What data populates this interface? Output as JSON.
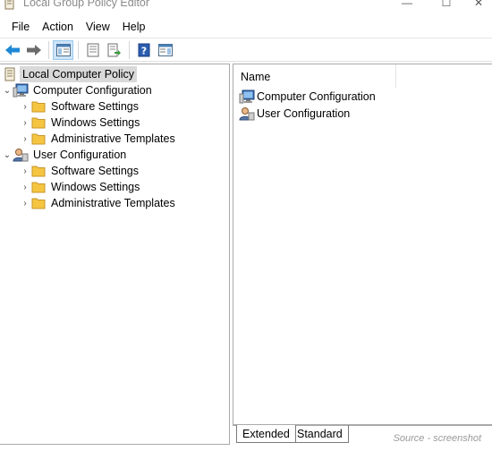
{
  "window": {
    "title": "Local Group Policy Editor",
    "minimize_glyph": "—",
    "maximize_glyph": "☐",
    "close_glyph": "✕"
  },
  "menu": [
    "File",
    "Action",
    "View",
    "Help"
  ],
  "toolbar": {
    "buttons": [
      "back-icon",
      "forward-icon",
      "show-hide-console-tree-icon",
      "properties-icon",
      "export-list-icon",
      "help-icon",
      "action-pane-icon"
    ]
  },
  "tree": {
    "root": "Local Computer Policy",
    "computer": {
      "label": "Computer Configuration",
      "children": [
        "Software Settings",
        "Windows Settings",
        "Administrative Templates"
      ]
    },
    "user": {
      "label": "User Configuration",
      "children": [
        "Software Settings",
        "Windows Settings",
        "Administrative Templates"
      ]
    }
  },
  "list": {
    "column_name": "Name",
    "items": [
      "Computer Configuration",
      "User Configuration"
    ]
  },
  "tabs": [
    "Extended",
    "Standard"
  ],
  "watermark": "Source - screenshot",
  "colors": {
    "folder": "#f5c542",
    "back_arrow": "#1e88d6",
    "selected_bg": "#d9d9d9"
  }
}
